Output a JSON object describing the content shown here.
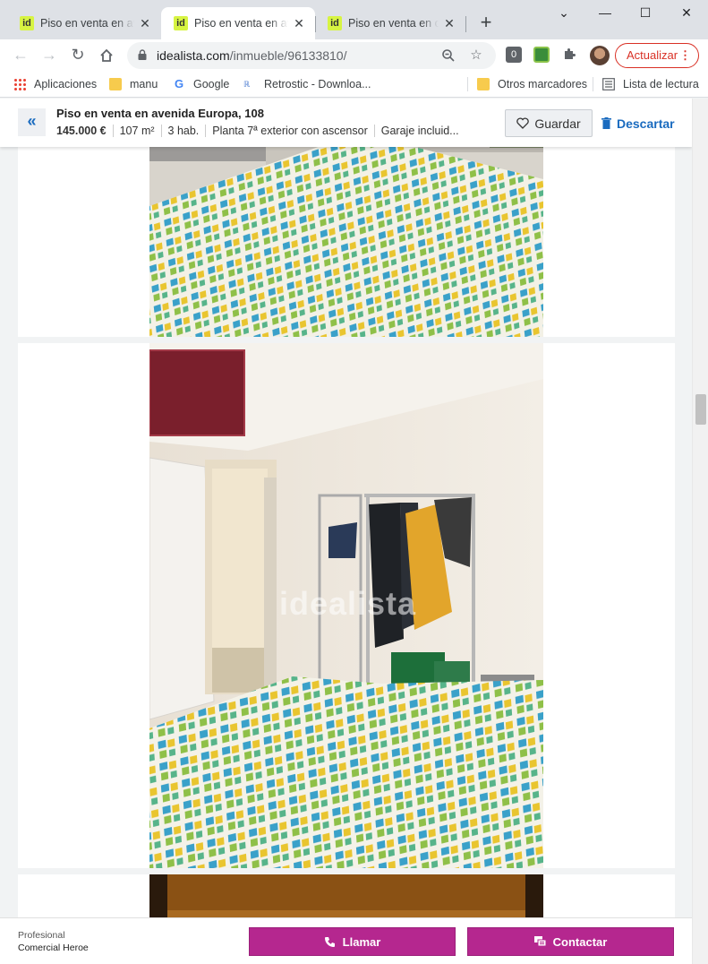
{
  "browser": {
    "tabs": [
      {
        "title": "Piso en venta en avenida Europa, 108",
        "active": false,
        "favicon": "id"
      },
      {
        "title": "Piso en venta en avenida Europa, 108",
        "active": true,
        "favicon": "id"
      },
      {
        "title": "Piso en venta en calle",
        "active": false,
        "favicon": "id"
      }
    ],
    "url_domain": "idealista.com",
    "url_path": "/inmueble/96133810/",
    "update_label": "Actualizar",
    "bookmarks": [
      {
        "label": "Aplicaciones",
        "icon": "apps-grid-icon"
      },
      {
        "label": "manu",
        "icon": "folder-icon"
      },
      {
        "label": "Google",
        "icon": "google-icon"
      },
      {
        "label": "Retrostic - Downloa...",
        "icon": "retrostic-icon"
      }
    ],
    "other_bookmarks": "Otros marcadores",
    "reading_list": "Lista de lectura"
  },
  "listing": {
    "title": "Piso en venta en avenida Europa, 108",
    "price": "145.000 €",
    "area": "107 m²",
    "rooms": "3 hab.",
    "floor": "Planta 7ª exterior con ascensor",
    "garage": "Garaje incluid...",
    "save_label": "Guardar",
    "discard_label": "Descartar",
    "watermark": "idealista"
  },
  "contact": {
    "agent_type": "Profesional",
    "agent_name": "Comercial Heroe",
    "call_label": "Llamar",
    "contact_label": "Contactar"
  },
  "colors": {
    "accent_blue": "#1a6bbf",
    "cta_magenta": "#b5278f",
    "favicon_lime": "#d7f442",
    "update_red": "#d93025"
  }
}
